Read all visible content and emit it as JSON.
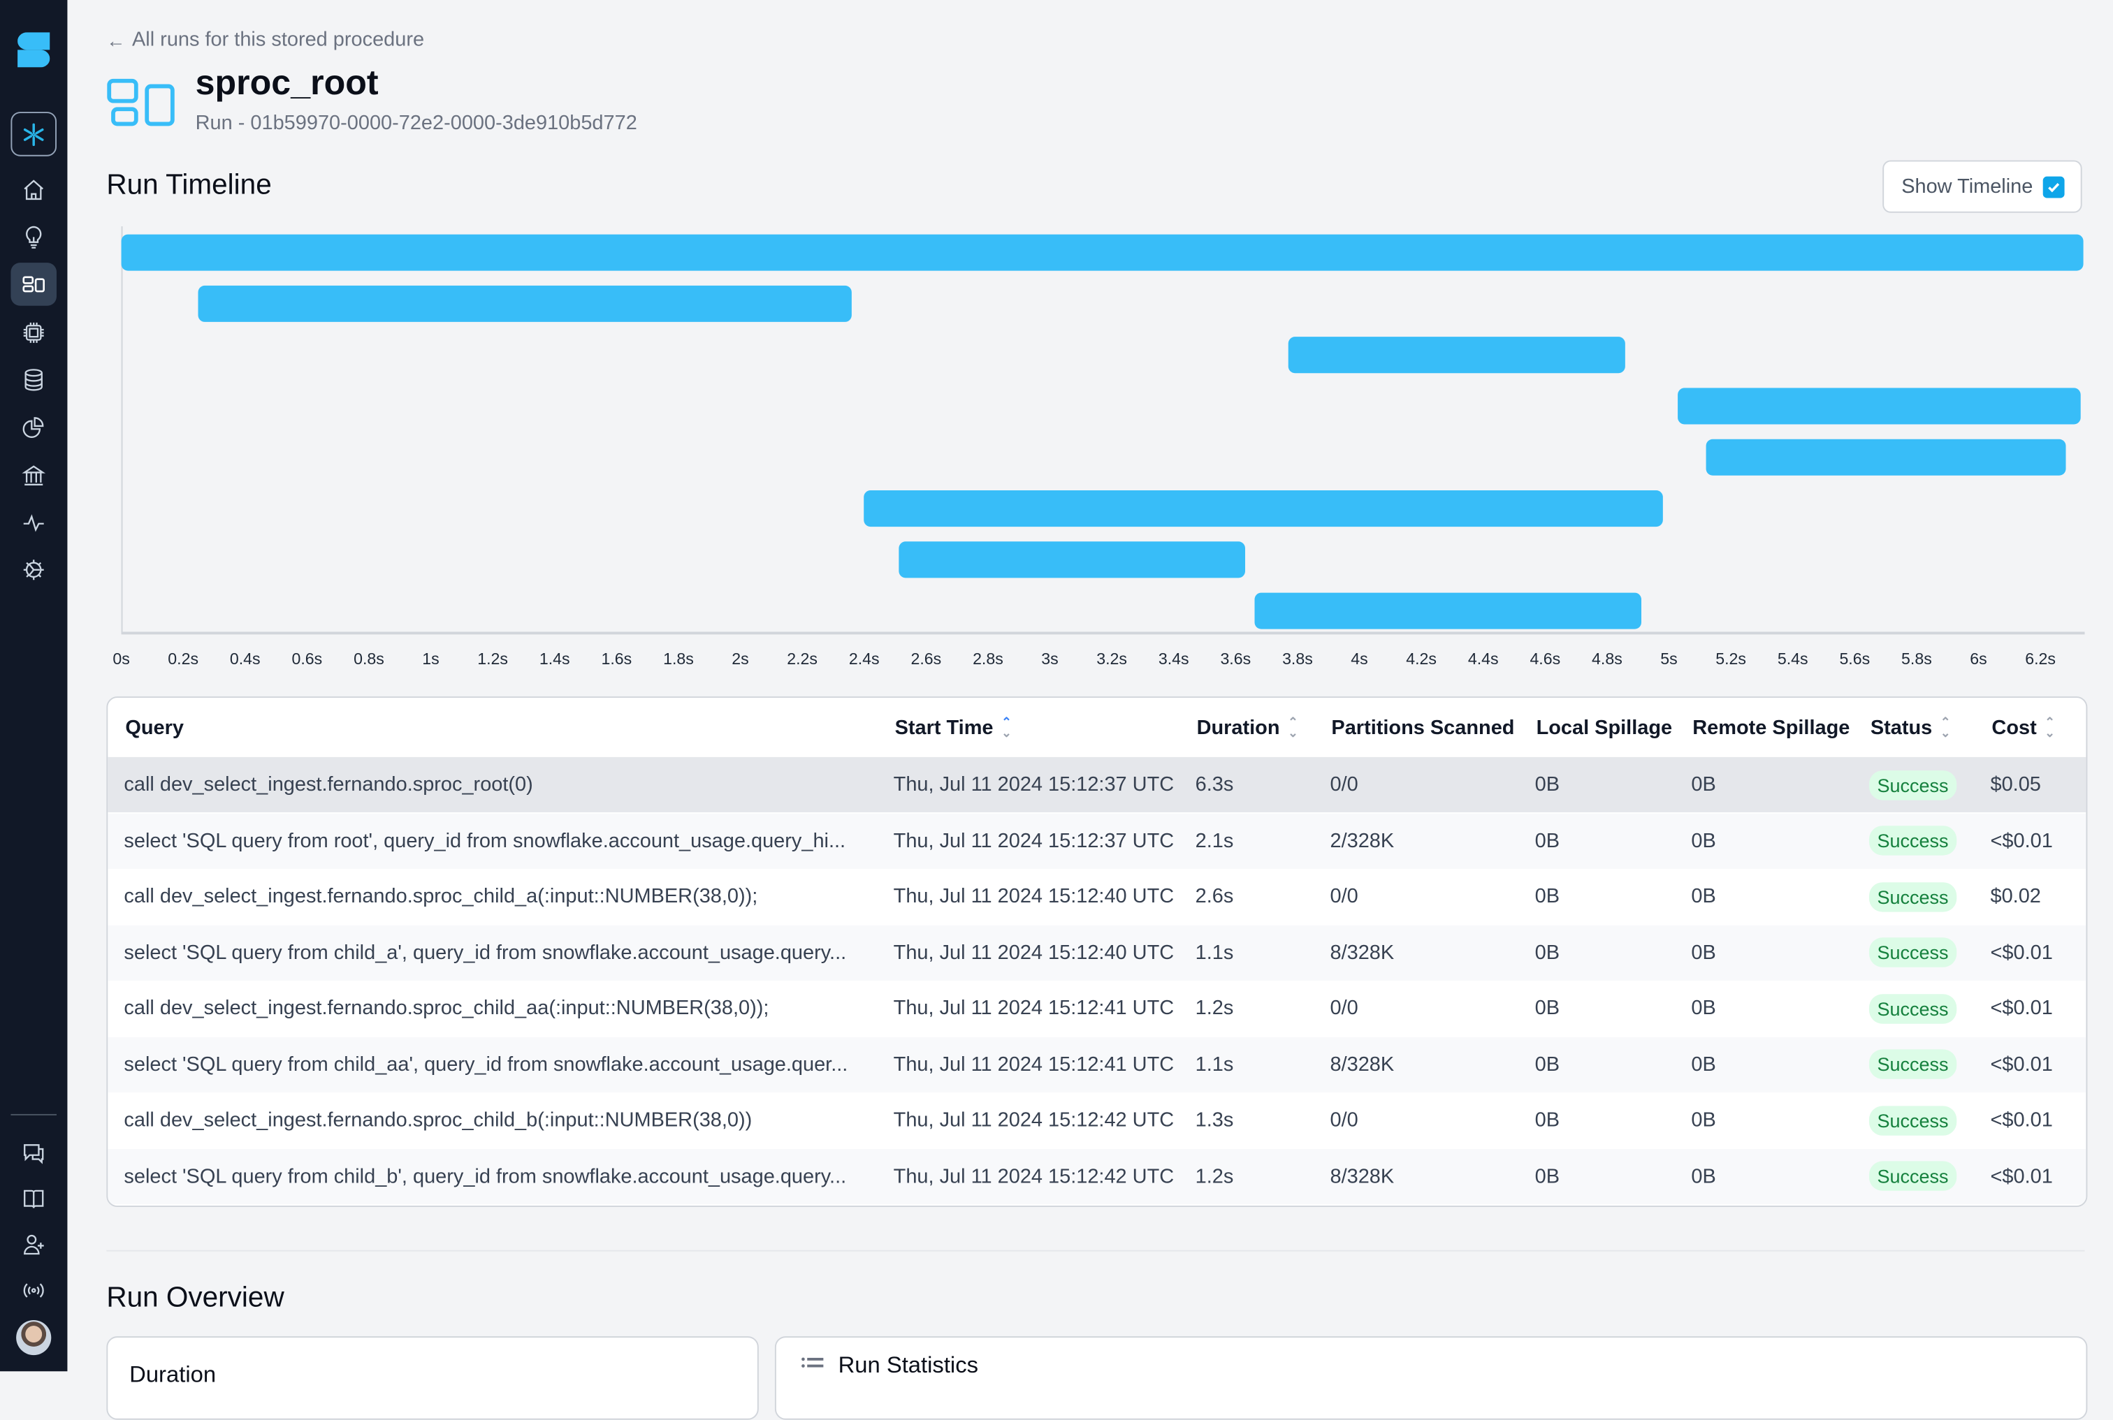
{
  "sidebar": {
    "logo": "app-logo",
    "items": [
      {
        "name": "snowflake-account",
        "icon": "snowflake-icon"
      },
      {
        "name": "home",
        "icon": "home-icon"
      },
      {
        "name": "insights",
        "icon": "lightbulb-icon"
      },
      {
        "name": "stored-procedures",
        "icon": "layout-blocks-icon",
        "active": true
      },
      {
        "name": "compute",
        "icon": "chip-icon"
      },
      {
        "name": "databases",
        "icon": "database-icon"
      },
      {
        "name": "analytics",
        "icon": "pie-chart-icon"
      },
      {
        "name": "governance",
        "icon": "bank-icon"
      },
      {
        "name": "activity",
        "icon": "activity-icon"
      },
      {
        "name": "settings",
        "icon": "gear-icon"
      }
    ],
    "bottom_items": [
      {
        "name": "feedback",
        "icon": "chat-icon"
      },
      {
        "name": "docs",
        "icon": "book-icon"
      },
      {
        "name": "invite-user",
        "icon": "user-plus-icon"
      },
      {
        "name": "status",
        "icon": "broadcast-icon"
      }
    ]
  },
  "header": {
    "back_link": "All runs for this stored procedure",
    "title": "sproc_root",
    "subtitle": "Run - 01b59970-0000-72e2-0000-3de910b5d772"
  },
  "timeline": {
    "title": "Run Timeline",
    "show_timeline_label": "Show Timeline",
    "show_timeline_checked": true,
    "bar_color": "#38bdf8"
  },
  "chart_data": {
    "type": "bar",
    "orientation": "horizontal-gantt",
    "title": "Run Timeline",
    "xlabel": "",
    "ylabel": "",
    "xlim": [
      0,
      6.35
    ],
    "x_unit": "s",
    "x_ticks": [
      "0s",
      "0.2s",
      "0.4s",
      "0.6s",
      "0.8s",
      "1s",
      "1.2s",
      "1.4s",
      "1.6s",
      "1.8s",
      "2s",
      "2.2s",
      "2.4s",
      "2.6s",
      "2.8s",
      "3s",
      "3.2s",
      "3.4s",
      "3.6s",
      "3.8s",
      "4s",
      "4.2s",
      "4.4s",
      "4.6s",
      "4.8s",
      "5s",
      "5.2s",
      "5.4s",
      "5.6s",
      "5.8s",
      "6s",
      "6.2s"
    ],
    "x_tick_values": [
      0,
      0.2,
      0.4,
      0.6,
      0.8,
      1,
      1.2,
      1.4,
      1.6,
      1.8,
      2,
      2.2,
      2.4,
      2.6,
      2.8,
      3,
      3.2,
      3.4,
      3.6,
      3.8,
      4,
      4.2,
      4.4,
      4.6,
      4.8,
      5,
      5.2,
      5.4,
      5.6,
      5.8,
      6,
      6.2
    ],
    "grid": false,
    "bars": [
      {
        "start": 0.0,
        "end": 6.34
      },
      {
        "start": 0.25,
        "end": 2.36
      },
      {
        "start": 3.77,
        "end": 4.86
      },
      {
        "start": 5.03,
        "end": 6.33
      },
      {
        "start": 5.12,
        "end": 6.28
      },
      {
        "start": 2.4,
        "end": 4.98
      },
      {
        "start": 2.51,
        "end": 3.63
      },
      {
        "start": 3.66,
        "end": 4.91
      }
    ]
  },
  "table": {
    "columns": [
      {
        "label": "Query",
        "sortable": false
      },
      {
        "label": "Start Time",
        "sortable": true,
        "sorted": "asc"
      },
      {
        "label": "Duration",
        "sortable": true
      },
      {
        "label": "Partitions Scanned",
        "sortable": false
      },
      {
        "label": "Local Spillage",
        "sortable": false
      },
      {
        "label": "Remote Spillage",
        "sortable": false
      },
      {
        "label": "Status",
        "sortable": true
      },
      {
        "label": "Cost",
        "sortable": true
      }
    ],
    "rows": [
      {
        "query": "call dev_select_ingest.fernando.sproc_root(0)",
        "start": "Thu, Jul 11 2024 15:12:37 UTC",
        "duration": "6.3s",
        "partitions": "0/0",
        "local": "0B",
        "remote": "0B",
        "status": "Success",
        "cost": "$0.05",
        "selected": true
      },
      {
        "query": "select 'SQL query from root', query_id from snowflake.account_usage.query_hi...",
        "start": "Thu, Jul 11 2024 15:12:37 UTC",
        "duration": "2.1s",
        "partitions": "2/328K",
        "local": "0B",
        "remote": "0B",
        "status": "Success",
        "cost": "<$0.01"
      },
      {
        "query": "call dev_select_ingest.fernando.sproc_child_a(:input::NUMBER(38,0));",
        "start": "Thu, Jul 11 2024 15:12:40 UTC",
        "duration": "2.6s",
        "partitions": "0/0",
        "local": "0B",
        "remote": "0B",
        "status": "Success",
        "cost": "$0.02"
      },
      {
        "query": "select 'SQL query from child_a', query_id from snowflake.account_usage.query...",
        "start": "Thu, Jul 11 2024 15:12:40 UTC",
        "duration": "1.1s",
        "partitions": "8/328K",
        "local": "0B",
        "remote": "0B",
        "status": "Success",
        "cost": "<$0.01"
      },
      {
        "query": "call dev_select_ingest.fernando.sproc_child_aa(:input::NUMBER(38,0));",
        "start": "Thu, Jul 11 2024 15:12:41 UTC",
        "duration": "1.2s",
        "partitions": "0/0",
        "local": "0B",
        "remote": "0B",
        "status": "Success",
        "cost": "<$0.01"
      },
      {
        "query": "select 'SQL query from child_aa', query_id from snowflake.account_usage.quer...",
        "start": "Thu, Jul 11 2024 15:12:41 UTC",
        "duration": "1.1s",
        "partitions": "8/328K",
        "local": "0B",
        "remote": "0B",
        "status": "Success",
        "cost": "<$0.01"
      },
      {
        "query": "call dev_select_ingest.fernando.sproc_child_b(:input::NUMBER(38,0))",
        "start": "Thu, Jul 11 2024 15:12:42 UTC",
        "duration": "1.3s",
        "partitions": "0/0",
        "local": "0B",
        "remote": "0B",
        "status": "Success",
        "cost": "<$0.01"
      },
      {
        "query": "select 'SQL query from child_b', query_id from snowflake.account_usage.query...",
        "start": "Thu, Jul 11 2024 15:12:42 UTC",
        "duration": "1.2s",
        "partitions": "8/328K",
        "local": "0B",
        "remote": "0B",
        "status": "Success",
        "cost": "<$0.01"
      }
    ]
  },
  "overview": {
    "title": "Run Overview",
    "left_card_title": "Duration",
    "right_card_title": "Run Statistics"
  },
  "colors": {
    "accent": "#0ea5e9",
    "sidebar_bg": "#111827",
    "success_bg": "#dcfce7",
    "success_text": "#15803d"
  }
}
